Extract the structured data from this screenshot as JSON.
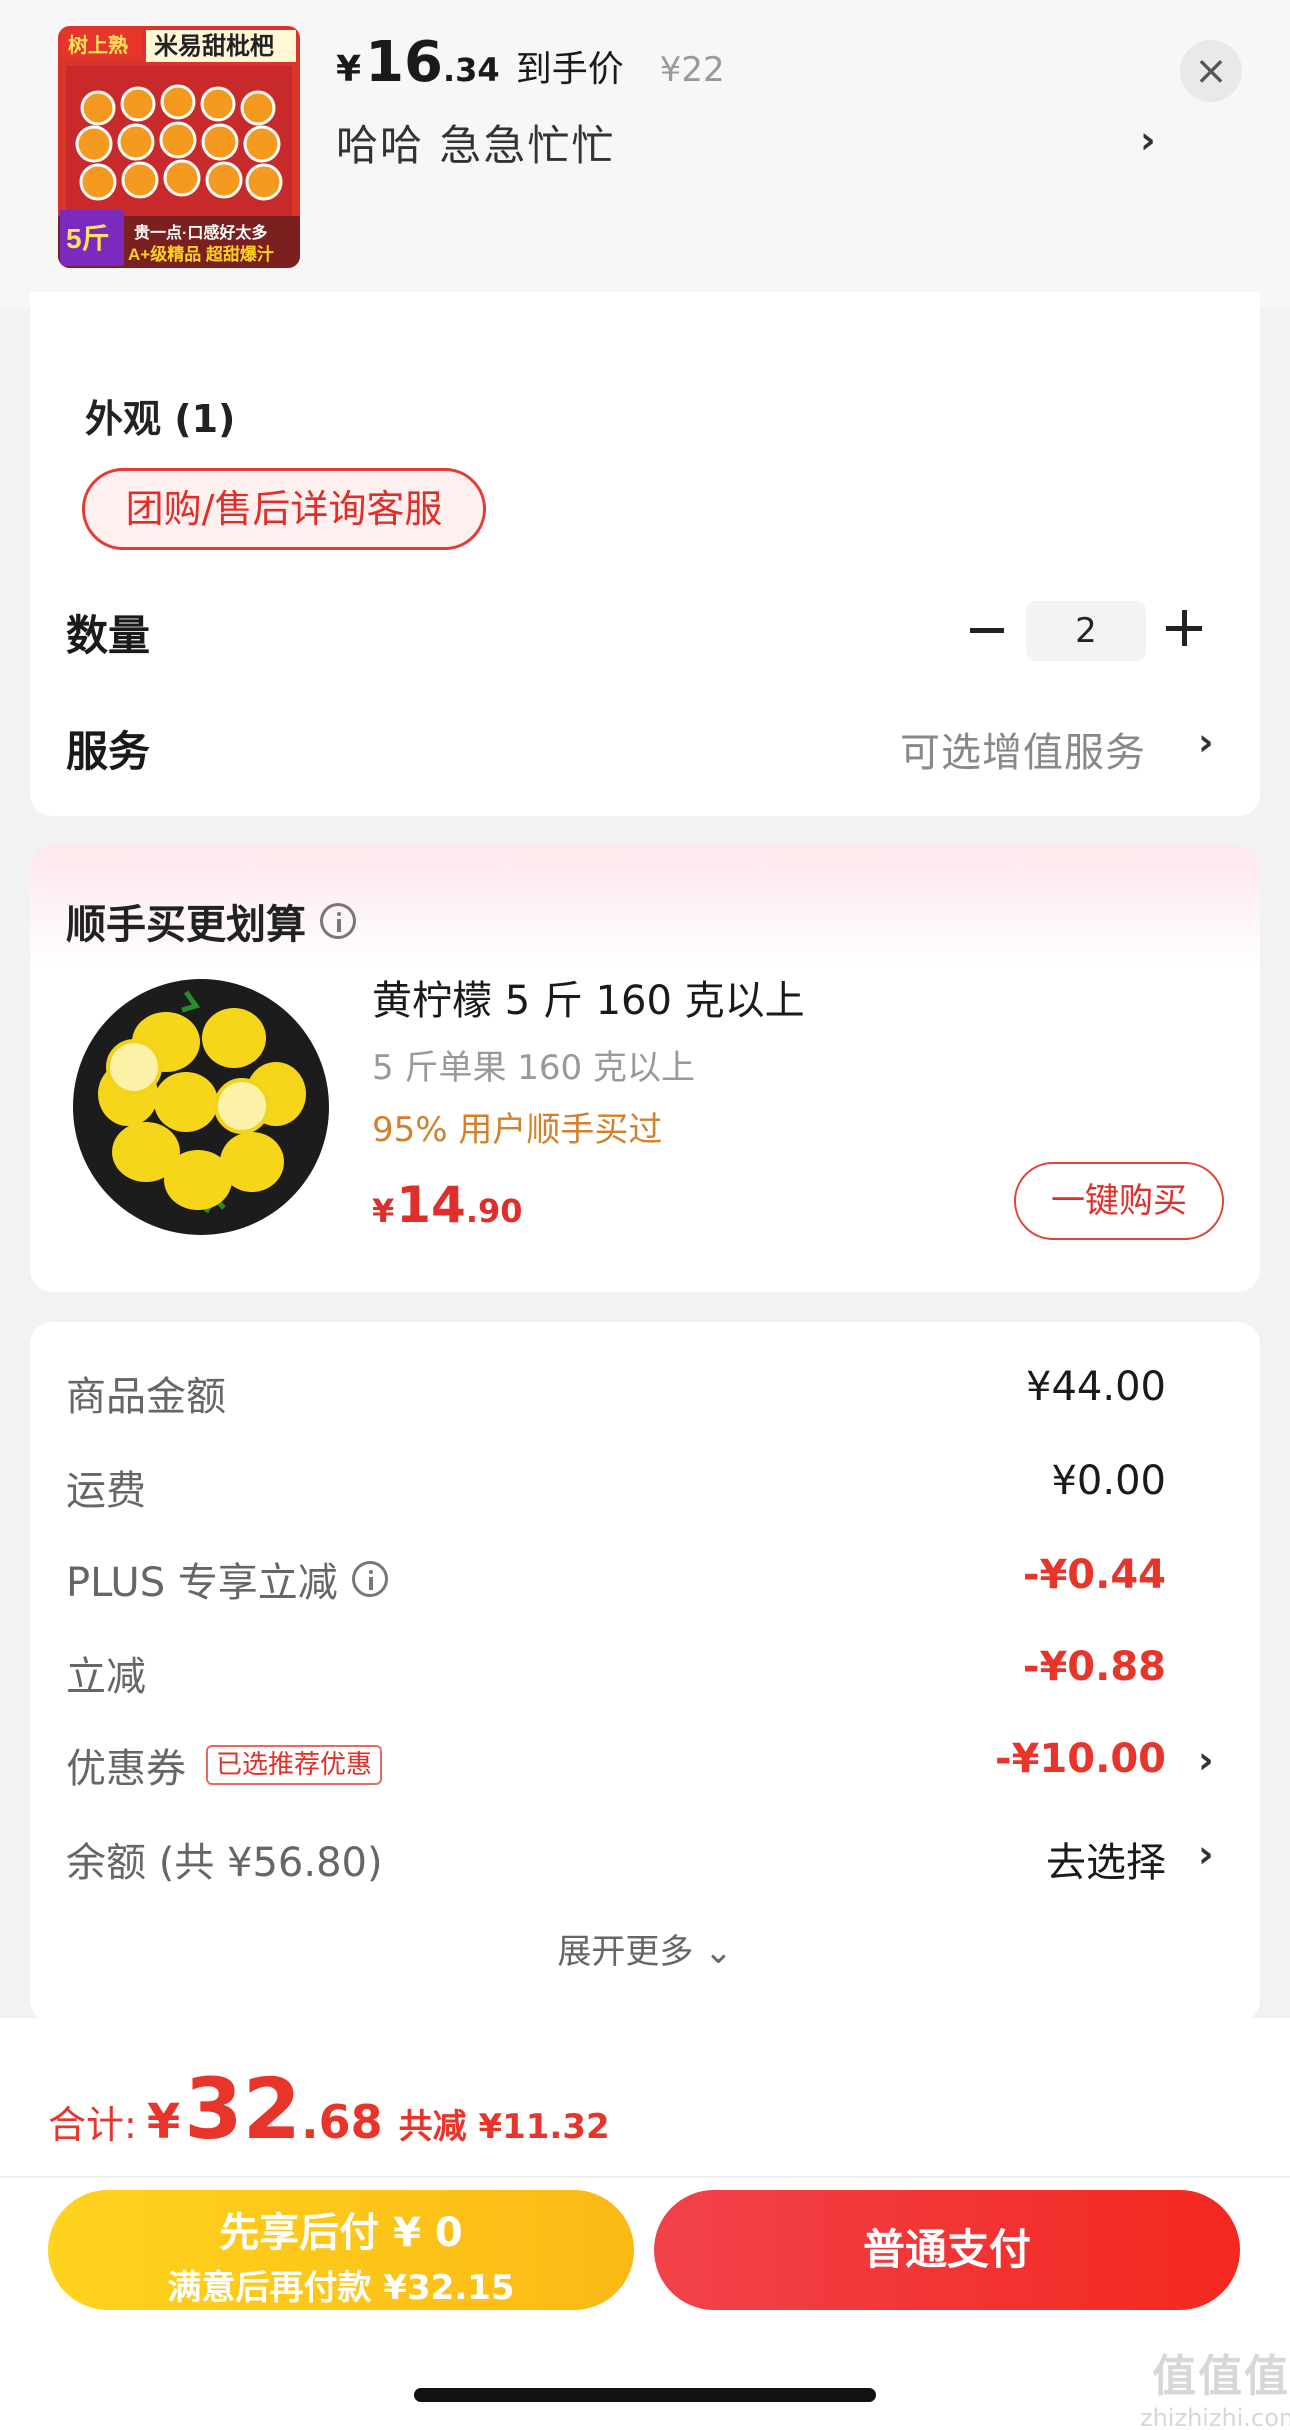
{
  "header": {
    "currency": "¥",
    "price_int": "16",
    "price_dec": ".34",
    "price_tag": "到手价",
    "original_price": "¥22",
    "variant": "哈哈  急急忙忙",
    "close_icon": "close-icon",
    "thumbnail": {
      "banner_top": "树上熟",
      "title": "米易甜枇杷",
      "weight": "5斤",
      "slogan1": "贵一点·口感好太多",
      "slogan2": "A+级精品 超甜爆汁"
    }
  },
  "options": {
    "section_label": "外观 (1)",
    "selected_tag": "团购/售后详询客服",
    "quantity_label": "数量",
    "quantity_value": "2",
    "service_label": "服务",
    "service_value": "可选增值服务"
  },
  "recommend": {
    "title": "顺手买更划算",
    "product_name": "黄柠檬 5 斤 160 克以上",
    "product_sub": "5 斤单果 160 克以上",
    "social_proof": "95% 用户顺手买过",
    "price_currency": "¥",
    "price_int": "14",
    "price_dec": ".90",
    "buy_label": "一键购买"
  },
  "fees": [
    {
      "label": "商品金额",
      "value": "¥44.00",
      "red": false
    },
    {
      "label": "运费",
      "value": "¥0.00",
      "red": false
    },
    {
      "label": "PLUS 专享立减",
      "value": "-¥0.44",
      "red": true
    },
    {
      "label": "立减",
      "value": "-¥0.88",
      "red": true
    },
    {
      "label": "优惠券",
      "value": "-¥10.00",
      "red": true,
      "tag": "已选推荐优惠"
    },
    {
      "label": "余额 (共 ¥56.80)",
      "value": "去选择",
      "red": false
    }
  ],
  "expand_label": "展开更多 ⌄",
  "footer": {
    "total_label": "合计:",
    "total_currency": "¥",
    "total_int": "32",
    "total_dec": ".68",
    "total_saved": "共减 ¥11.32",
    "pay_later_main": "先享后付 ¥ 0",
    "pay_later_sub": "满意后再付款 ¥32.15",
    "pay_normal": "普通支付"
  },
  "watermark": {
    "big": "值值值",
    "small": "zhizhizhi.com"
  },
  "colors": {
    "accent_red": "#e8352c",
    "orange_text": "#d2812a",
    "pay_later_yellow": "#ffd31d"
  }
}
